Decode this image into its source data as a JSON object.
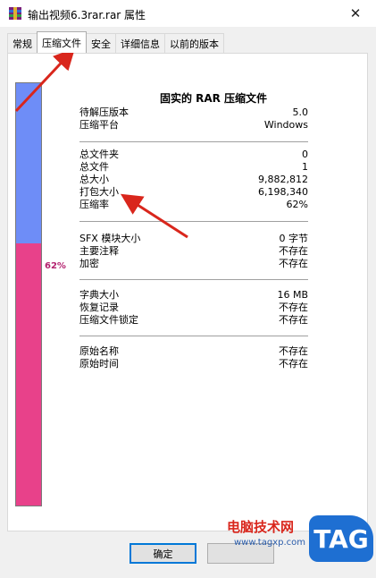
{
  "window": {
    "title": "输出视频6.3rar.rar 属性",
    "close": "✕"
  },
  "tabs": [
    {
      "label": "常规",
      "active": false
    },
    {
      "label": "压缩文件",
      "active": true
    },
    {
      "label": "安全",
      "active": false
    },
    {
      "label": "详细信息",
      "active": false
    },
    {
      "label": "以前的版本",
      "active": false
    }
  ],
  "panel": {
    "title": "固实的 RAR 压缩文件",
    "ratio_label": "62%",
    "ratio_value": 0.62,
    "bar_free_color": "#6e8df7",
    "bar_used_color": "#e8418a"
  },
  "group1": [
    {
      "label": "待解压版本",
      "value": "5.0"
    },
    {
      "label": "压缩平台",
      "value": "Windows"
    }
  ],
  "group2": [
    {
      "label": "总文件夹",
      "value": "0"
    },
    {
      "label": "总文件",
      "value": "1"
    },
    {
      "label": "总大小",
      "value": "9,882,812"
    },
    {
      "label": "打包大小",
      "value": "6,198,340"
    },
    {
      "label": "压缩率",
      "value": "62%"
    }
  ],
  "group3": [
    {
      "label": "SFX 模块大小",
      "value": "0 字节"
    },
    {
      "label": "主要注释",
      "value": "不存在"
    },
    {
      "label": "加密",
      "value": "不存在"
    }
  ],
  "group4": [
    {
      "label": "字典大小",
      "value": "16 MB"
    },
    {
      "label": "恢复记录",
      "value": "不存在"
    },
    {
      "label": "压缩文件锁定",
      "value": "不存在"
    }
  ],
  "group5": [
    {
      "label": "原始名称",
      "value": "不存在"
    },
    {
      "label": "原始时间",
      "value": "不存在"
    }
  ],
  "buttons": {
    "ok": "确定",
    "cancel": ""
  },
  "watermark": {
    "site_name": "电脑技术网",
    "url": "www.tagxp.com",
    "logo": "TAG",
    "colors": {
      "red": "#d9261c",
      "blue": "#1e6fd2"
    }
  },
  "annotation_color": "#d9261c"
}
